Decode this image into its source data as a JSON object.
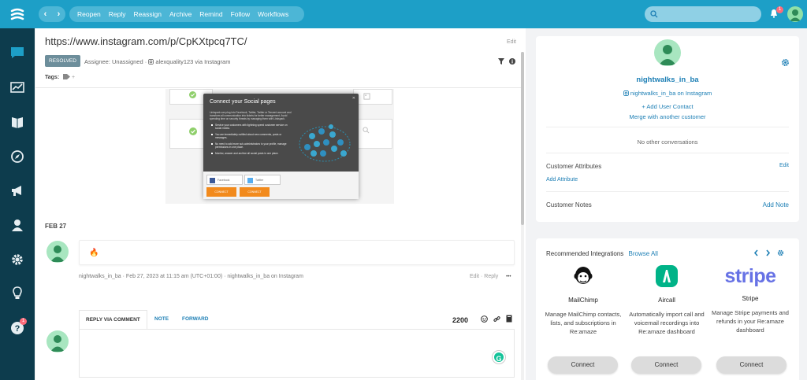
{
  "topbar": {
    "nav_prev": "‹",
    "nav_next": "›",
    "actions": [
      "Reopen",
      "Reply",
      "Reassign",
      "Archive",
      "Remind",
      "Follow",
      "Workflows"
    ],
    "search_placeholder": "",
    "notification_count": "1"
  },
  "sidebar": {
    "items": [
      "chat-icon",
      "analytics-icon",
      "knowledge-book-icon",
      "compass-icon",
      "megaphone-icon",
      "contacts-icon",
      "settings-icon",
      "lightbulb-icon",
      "help-icon"
    ],
    "help_badge": "1"
  },
  "conversation": {
    "title": "https://www.instagram.com/p/CpKXtpcq7TC/",
    "edit_label": "Edit",
    "status": "RESOLVED",
    "assignee": "Assignee: Unassigned · ",
    "channel": "alexquality123 via Instagram",
    "tags_label": "Tags:",
    "tags_plus": "+",
    "embedded_modal": {
      "title": "Connect your Social pages",
      "intro": "Linkspark can plug into Facebook, Twitter, Twitter or Tencent account and transform all communication into tickets for better management. Avoid spending time on security threats by managing them with Linkspark.",
      "bullets": [
        "Service your customers with lightning speed customer service on social media.",
        "You are immediately notified about new comments, posts or messages.",
        "No need to add more sub-administrators to your profile, manage permissions in one place.",
        "Monitor, answer and archive all social posts in one place."
      ],
      "facebook_label": "Facebook",
      "twitter_label": "Twitter",
      "connect_label": "CONNECT"
    },
    "date_divider": "FEB 27",
    "message_emoji": "🔥",
    "message_meta": "nightwalks_in_ba · Feb 27, 2023 at 11:15 am (UTC+01:00) · nightwalks_in_ba on Instagram",
    "message_edit": "Edit",
    "message_reply": "Reply",
    "message_more": "•••",
    "reply_tabs": [
      "REPLY VIA COMMENT",
      "NOTE",
      "FORWARD"
    ],
    "char_counter": "2200",
    "grammarly": "G"
  },
  "customer": {
    "name": "nightwalks_in_ba",
    "handle": "nightwalks_in_ba on Instagram",
    "add_contact": "+ Add User Contact",
    "merge": "Merge with another customer",
    "no_conversations": "No other conversations",
    "attributes_label": "Customer Attributes",
    "attributes_edit": "Edit",
    "add_attribute": "Add Attribute",
    "notes_label": "Customer Notes",
    "add_note": "Add Note"
  },
  "integrations": {
    "title": "Recommended Integrations",
    "browse": "Browse All",
    "items": [
      {
        "name": "MailChimp",
        "desc": "Manage MailChimp contacts, lists, and subscriptions in Re:amaze",
        "button": "Connect"
      },
      {
        "name": "Aircall",
        "desc": "Automatically import call and voicemail recordings into Re:amaze dashboard",
        "button": "Connect"
      },
      {
        "name": "Stripe",
        "logo": "stripe",
        "desc": "Manage Stripe payments and refunds in your Re:amaze dashboard",
        "button": "Connect"
      }
    ]
  },
  "colors": {
    "topbar": "#1d9fc7",
    "sidebar": "#0d3c4d",
    "link": "#1d7fb5",
    "resolved": "#6d8e9b",
    "avatar": "#a8e6c0",
    "orange": "#f28a1c"
  }
}
